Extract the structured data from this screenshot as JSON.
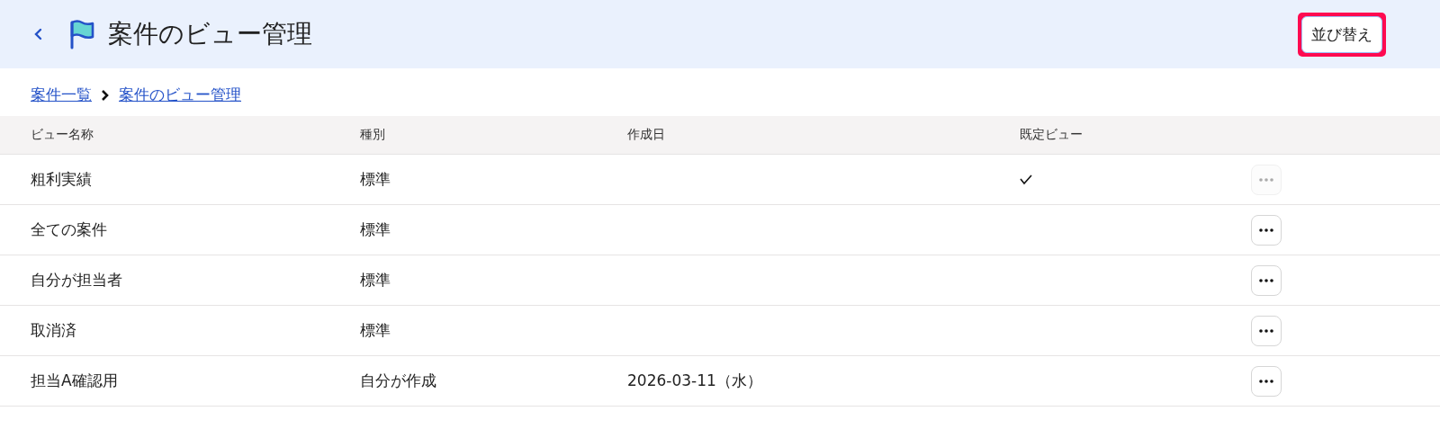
{
  "header": {
    "title": "案件のビュー管理",
    "sort_button": {
      "label": "並び替え",
      "highlighted": true
    }
  },
  "breadcrumb": [
    "案件一覧",
    "案件のビュー管理"
  ],
  "table": {
    "columns": [
      "ビュー名称",
      "種別",
      "作成日",
      "既定ビュー"
    ],
    "rows": [
      {
        "name": "粗利実績",
        "type": "標準",
        "created": "",
        "default": true,
        "menu_disabled": true
      },
      {
        "name": "全ての案件",
        "type": "標準",
        "created": "",
        "default": false,
        "menu_disabled": false
      },
      {
        "name": "自分が担当者",
        "type": "標準",
        "created": "",
        "default": false,
        "menu_disabled": false
      },
      {
        "name": "取消済",
        "type": "標準",
        "created": "",
        "default": false,
        "menu_disabled": false
      },
      {
        "name": "担当A確認用",
        "type": "自分が作成",
        "created": "2026-03-11（水）",
        "default": false,
        "menu_disabled": false
      }
    ]
  }
}
